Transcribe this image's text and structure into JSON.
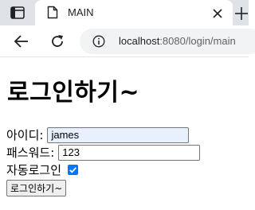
{
  "browser": {
    "tab": {
      "title": "MAIN"
    },
    "address": {
      "host": "localhost",
      "rest": ":8080/login/main"
    }
  },
  "icons": {
    "tab_strip": "tab-strip-icon",
    "favicon": "page-icon",
    "close": "close-icon",
    "new_tab": "plus-icon",
    "back": "arrow-left-icon",
    "reload": "reload-icon",
    "info": "info-icon",
    "checkbox": "check-icon"
  },
  "colors": {
    "checkbox": "#0075ff",
    "autofill": "#e8f0fe"
  },
  "page": {
    "heading": "로그인하기~",
    "id_label": "아이디:",
    "id_value": "james",
    "pw_label": "패스워드:",
    "pw_value": "123",
    "auto_login_label": "자동로그인",
    "auto_login_checked": true,
    "submit_label": "로그인하기~"
  }
}
